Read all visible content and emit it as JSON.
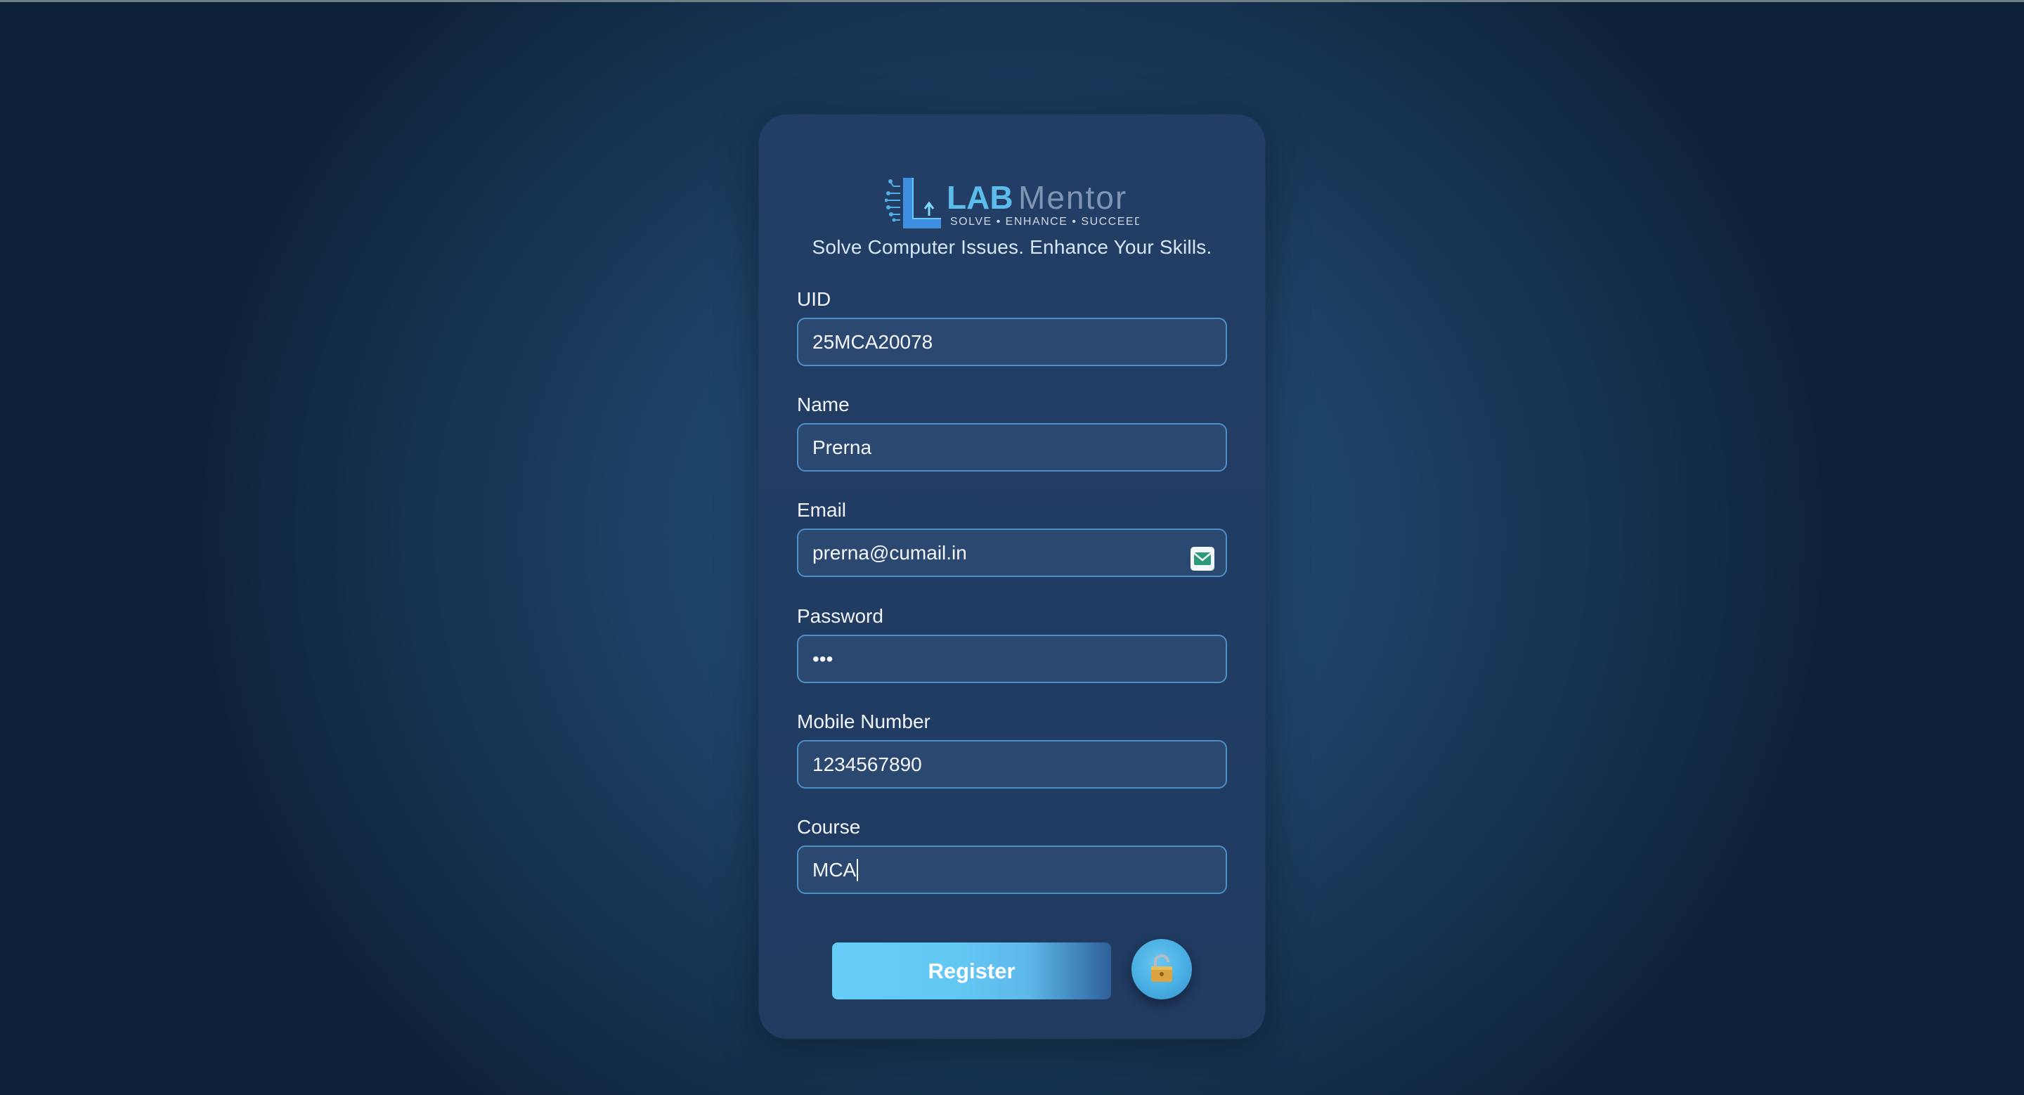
{
  "brand": {
    "name_part1": "LAB",
    "name_part2": "Mentor",
    "slogan": "SOLVE • ENHANCE • SUCCEED",
    "tagline": "Solve Computer Issues. Enhance Your Skills.",
    "colors": {
      "accent": "#4fb6e8",
      "accent_light": "#6fd2f7",
      "muted": "#7d93b0"
    }
  },
  "form": {
    "uid": {
      "label": "UID",
      "value": "25MCA20078"
    },
    "name": {
      "label": "Name",
      "value": "Prerna"
    },
    "email": {
      "label": "Email",
      "value": "prerna@cumail.in",
      "icon": "mail-icon"
    },
    "password": {
      "label": "Password",
      "value": "•••"
    },
    "mobile": {
      "label": "Mobile Number",
      "value": "1234567890"
    },
    "course": {
      "label": "Course",
      "value": "MCA"
    }
  },
  "actions": {
    "register_label": "Register",
    "lock_icon": "lock-icon"
  }
}
